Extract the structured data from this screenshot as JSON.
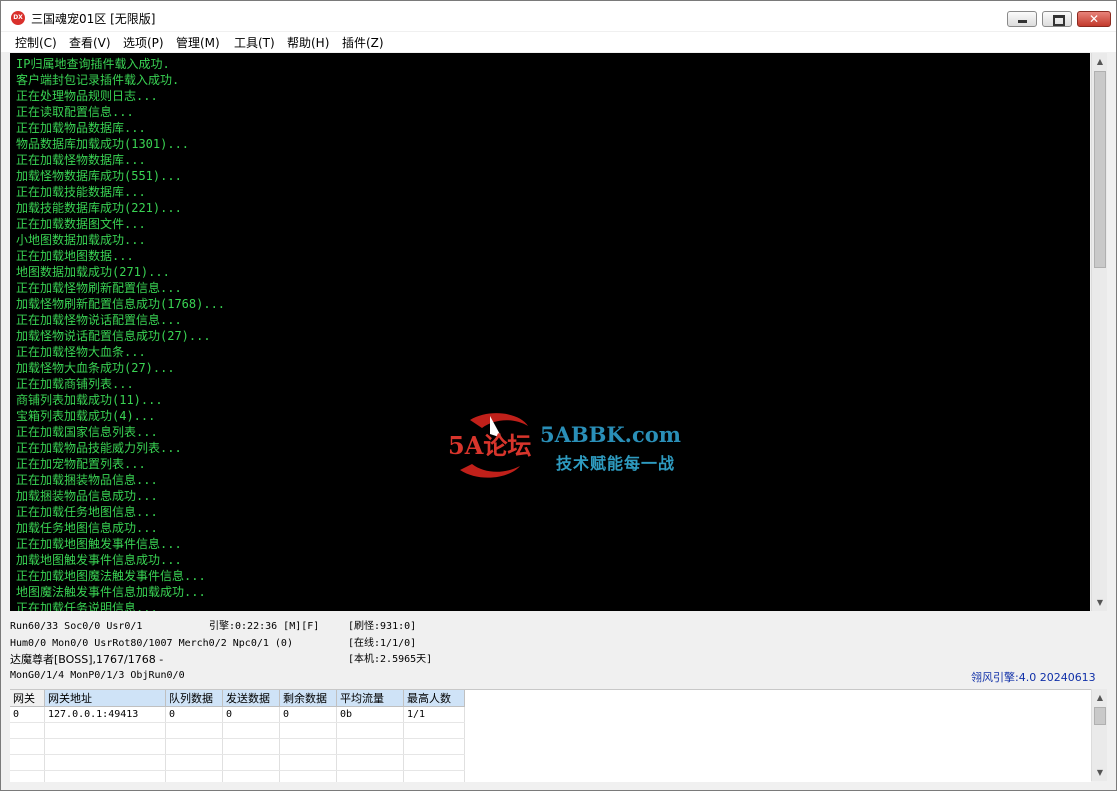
{
  "window": {
    "app_icon_text": "DX",
    "title": "三国魂宠01区 [无限版]",
    "close_glyph": "✕"
  },
  "menu": [
    {
      "label": "控制(C)"
    },
    {
      "label": "查看(V)"
    },
    {
      "label": "选项(P)"
    },
    {
      "label": "管理(M)"
    },
    {
      "label": "工具(T)"
    },
    {
      "label": "帮助(H)"
    },
    {
      "label": "插件(Z)"
    }
  ],
  "console": {
    "text_color": "#39d353",
    "background": "#000000",
    "lines": [
      "IP归属地查询插件载入成功.",
      "客户端封包记录插件载入成功.",
      "正在处理物品规则日志...",
      "正在读取配置信息...",
      "正在加载物品数据库...",
      "物品数据库加载成功(1301)...",
      "正在加载怪物数据库...",
      "加载怪物数据库成功(551)...",
      "正在加载技能数据库...",
      "加载技能数据库成功(221)...",
      "正在加载数据图文件...",
      "小地图数据加载成功...",
      "正在加载地图数据...",
      "地图数据加载成功(271)...",
      "正在加载怪物刷新配置信息...",
      "加载怪物刷新配置信息成功(1768)...",
      "正在加载怪物说话配置信息...",
      "加载怪物说话配置信息成功(27)...",
      "正在加载怪物大血条...",
      "加载怪物大血条成功(27)...",
      "正在加载商铺列表...",
      "商铺列表加载成功(11)...",
      "宝箱列表加载成功(4)...",
      "正在加载国家信息列表...",
      "正在加载物品技能威力列表...",
      "正在加宠物配置列表...",
      "正在加载捆装物品信息...",
      "加载捆装物品信息成功...",
      "正在加载任务地图信息...",
      "加载任务地图信息成功...",
      "正在加载地图触发事件信息...",
      "加载地图触发事件信息成功...",
      "正在加载地图魔法触发事件信息...",
      "地图魔法触发事件信息加载成功...",
      "正在加载任务说明信息..."
    ]
  },
  "watermark": {
    "logo_text": "5A论坛",
    "site": "5ABBK.com",
    "slogan": "技术赋能每一战"
  },
  "status": {
    "row1_left": "Run60/33 Soc0/0 Usr0/1",
    "row1_mid": "引擎:0:22:36 [M][F]",
    "row1_right": "[刷怪:931:0]",
    "row2_left": "Hum0/0 Mon0/0 UsrRot80/1007 Merch0/2 Npc0/1 (0)",
    "row2_right": "[在线:1/1/0]",
    "row3_left": "达魔尊者[BOSS],1767/1768 -",
    "row3_right": "[本机:2.5965天]",
    "row4_left": "MonG0/1/4 MonP0/1/3 ObjRun0/0",
    "engine": "翎风引擎:4.0 20240613"
  },
  "gateway_table": {
    "columns": [
      "网关",
      "网关地址",
      "队列数据",
      "发送数据",
      "剩余数据",
      "平均流量",
      "最高人数"
    ],
    "rows": [
      [
        "0",
        "127.0.0.1:49413",
        "0",
        "0",
        "0",
        "0b",
        "1/1"
      ]
    ]
  }
}
